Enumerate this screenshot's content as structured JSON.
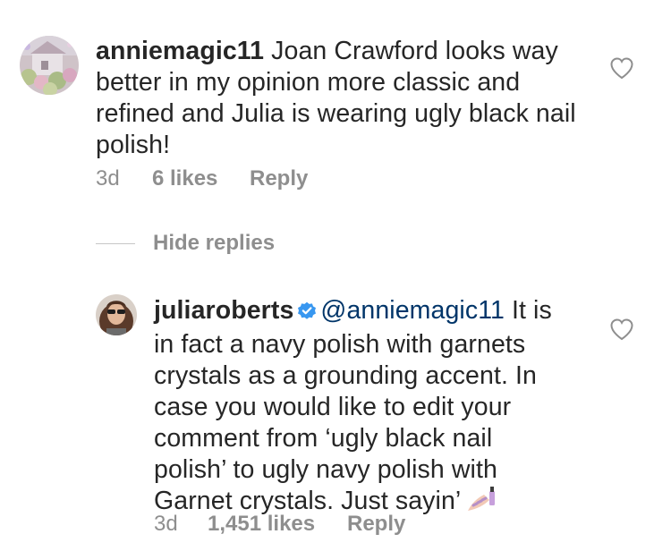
{
  "comments": [
    {
      "username": "anniemagic11",
      "text": " Joan Crawford looks way better in my opinion more classic and refined  and Julia is wearing ugly black nail polish!",
      "age": "3d",
      "likes": "6 likes",
      "reply": "Reply",
      "avatar_icon": "cottage-garden-avatar",
      "heart_icon": "heart-outline-icon"
    },
    {
      "username": "juliaroberts",
      "verified_icon": "verified-badge-icon",
      "mention": "@anniemagic11",
      "text": " It is in fact a navy polish with garnets crystals as a grounding accent. In case you would like to edit your comment from ‘ugly black nail polish’ to ugly navy polish with Garnet crystals. Just sayin’",
      "emoji": "nail-polish-emoji",
      "age": "3d",
      "likes": "1,451 likes",
      "reply": "Reply",
      "avatar_icon": "portrait-avatar",
      "heart_icon": "heart-outline-icon"
    }
  ],
  "replies_toggle": {
    "label": "Hide replies"
  },
  "colors": {
    "text": "#262626",
    "secondary": "#8e8e8e",
    "mention": "#003569",
    "verified": "#3897f0",
    "divider": "#c7c7c7"
  }
}
